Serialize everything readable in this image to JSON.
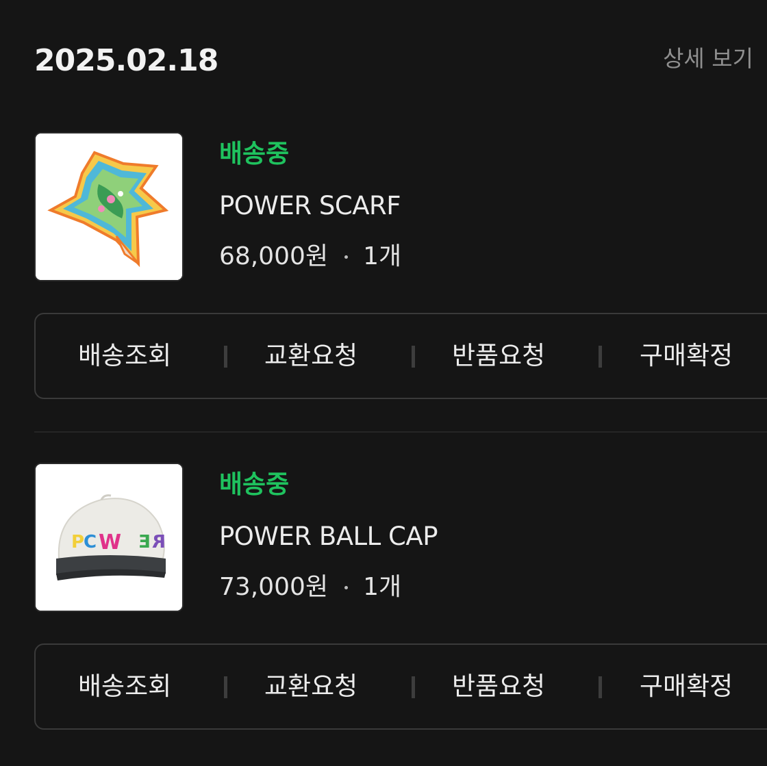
{
  "order_group": {
    "date": "2025.02.18",
    "detail_link": "상세 보기"
  },
  "items": [
    {
      "status": "배송중",
      "name": "POWER SCARF",
      "price": "68,000원",
      "quantity": "1개",
      "image": "scarf-product-image",
      "actions": [
        "배송조회",
        "교환요청",
        "반품요청",
        "구매확정"
      ]
    },
    {
      "status": "배송중",
      "name": "POWER BALL CAP",
      "price": "73,000원",
      "quantity": "1개",
      "image": "cap-product-image",
      "cap_text": "PCWER",
      "actions": [
        "배송조회",
        "교환요청",
        "반품요청",
        "구매확정"
      ]
    }
  ],
  "colors": {
    "background": "#151515",
    "status_green": "#1fc25e",
    "muted_text": "#8f8f8f"
  }
}
